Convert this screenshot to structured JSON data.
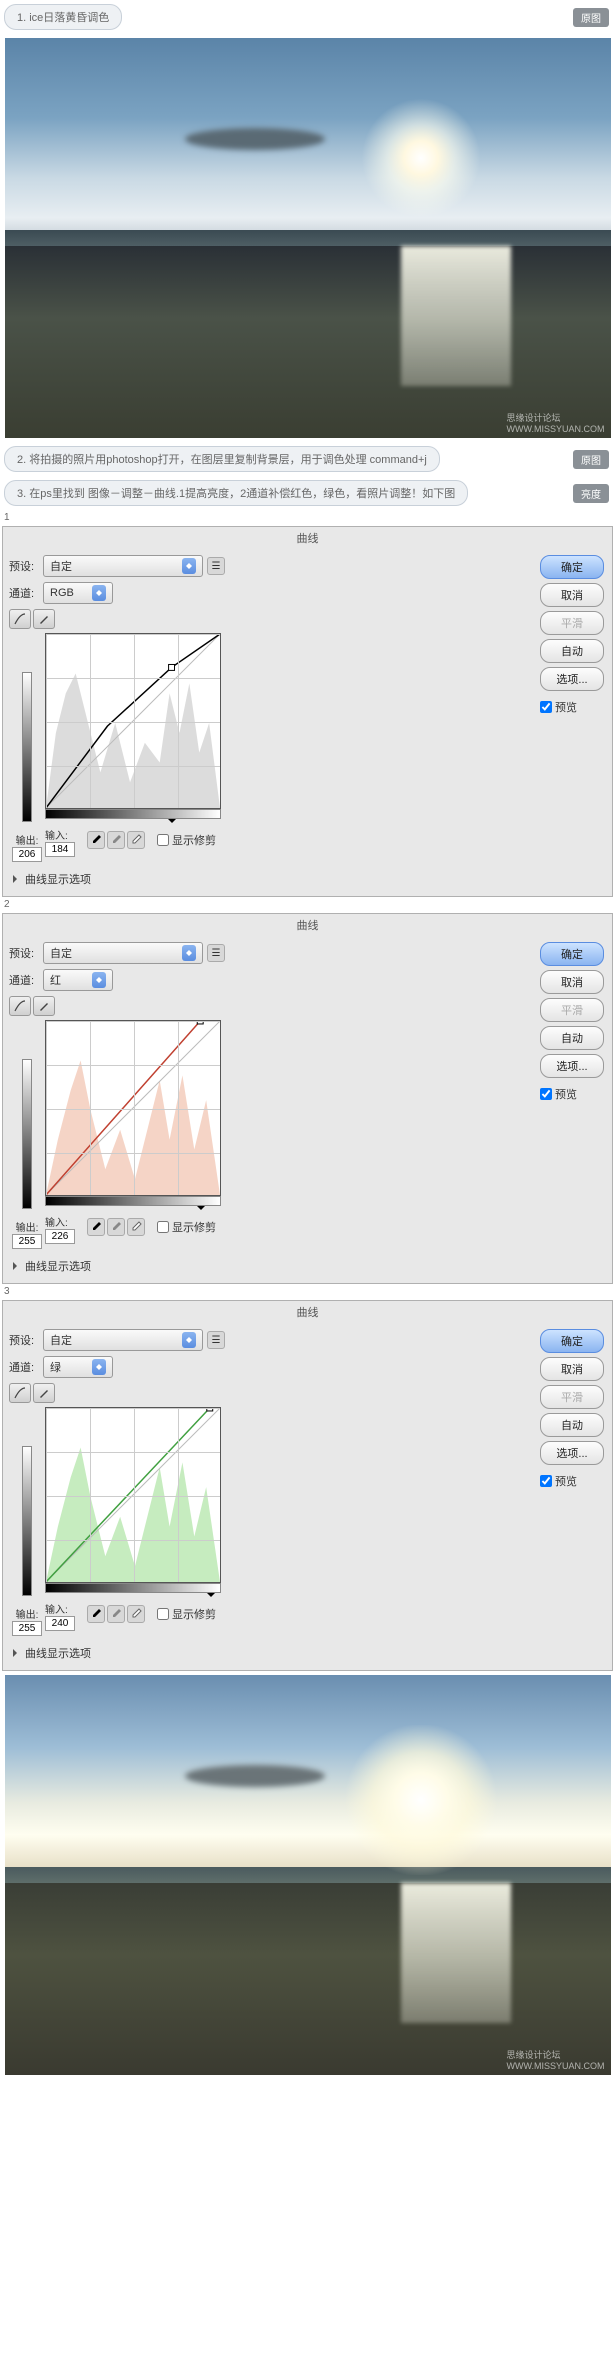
{
  "steps": {
    "s1": "1. ice日落黄昏调色",
    "s2": "2. 将拍摄的照片用photoshop打开，在图层里复制背景层，用于调色处理 command+j",
    "s3": "3. 在ps里找到 图像－调整－曲线.1提高亮度，2通道补偿红色，绿色，看照片调整！如下图",
    "btn_original": "原图",
    "btn_highlight": "亮度"
  },
  "dialogs": [
    {
      "num": "1",
      "title": "曲线",
      "preset_label": "预设:",
      "preset_value": "自定",
      "channel_label": "通道:",
      "channel_value": "RGB",
      "output_label": "输出:",
      "output_value": "206",
      "input_label": "输入:",
      "input_value": "184",
      "show_clip": "显示修剪",
      "disclosure": "曲线显示选项",
      "histo_color": "#d8d8d8",
      "buttons": {
        "ok": "确定",
        "cancel": "取消",
        "smooth": "平滑",
        "auto": "自动",
        "options": "选项...",
        "preview": "预览"
      }
    },
    {
      "num": "2",
      "title": "曲线",
      "preset_label": "预设:",
      "preset_value": "自定",
      "channel_label": "通道:",
      "channel_value": "红",
      "output_label": "输出:",
      "output_value": "255",
      "input_label": "输入:",
      "input_value": "226",
      "show_clip": "显示修剪",
      "disclosure": "曲线显示选项",
      "histo_color": "#f4cfc0",
      "buttons": {
        "ok": "确定",
        "cancel": "取消",
        "smooth": "平滑",
        "auto": "自动",
        "options": "选项...",
        "preview": "预览"
      }
    },
    {
      "num": "3",
      "title": "曲线",
      "preset_label": "预设:",
      "preset_value": "自定",
      "channel_label": "通道:",
      "channel_value": "绿",
      "output_label": "输出:",
      "output_value": "255",
      "input_label": "输入:",
      "input_value": "240",
      "show_clip": "显示修剪",
      "disclosure": "曲线显示选项",
      "histo_color": "#c0eab8",
      "buttons": {
        "ok": "确定",
        "cancel": "取消",
        "smooth": "平滑",
        "auto": "自动",
        "options": "选项...",
        "preview": "预览"
      }
    }
  ],
  "watermark": "思缘设计论坛",
  "watermark_url": "WWW.MISSYUAN.COM",
  "chart_data": [
    {
      "type": "line",
      "title": "曲线 RGB",
      "xlabel": "输入",
      "ylabel": "输出",
      "xlim": [
        0,
        255
      ],
      "ylim": [
        0,
        255
      ],
      "series": [
        {
          "name": "curve",
          "x": [
            0,
            90,
            184,
            255
          ],
          "y": [
            0,
            120,
            206,
            255
          ]
        }
      ],
      "control_point": {
        "input": 184,
        "output": 206
      },
      "histogram_visible": true
    },
    {
      "type": "line",
      "title": "曲线 红",
      "xlabel": "输入",
      "ylabel": "输出",
      "xlim": [
        0,
        255
      ],
      "ylim": [
        0,
        255
      ],
      "series": [
        {
          "name": "curve",
          "x": [
            0,
            226
          ],
          "y": [
            0,
            255
          ]
        }
      ],
      "control_point": {
        "input": 226,
        "output": 255
      },
      "histogram_visible": true
    },
    {
      "type": "line",
      "title": "曲线 绿",
      "xlabel": "输入",
      "ylabel": "输出",
      "xlim": [
        0,
        255
      ],
      "ylim": [
        0,
        255
      ],
      "series": [
        {
          "name": "curve",
          "x": [
            0,
            240
          ],
          "y": [
            0,
            255
          ]
        }
      ],
      "control_point": {
        "input": 240,
        "output": 255
      },
      "histogram_visible": true
    }
  ]
}
